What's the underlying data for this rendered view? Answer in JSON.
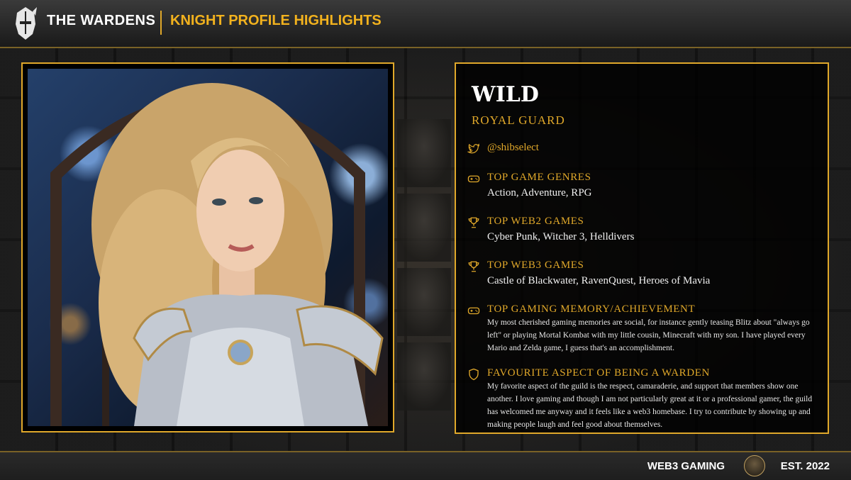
{
  "header": {
    "brand": "THE WARDENS",
    "subtitle": "KNIGHT PROFILE HIGHLIGHTS"
  },
  "profile": {
    "name": "WILD",
    "rank": "ROYAL GUARD",
    "handle": "@shibselect",
    "sections": [
      {
        "icon": "gamepad-icon",
        "heading": "TOP GAME GENRES",
        "value": "Action, Adventure, RPG"
      },
      {
        "icon": "trophy-icon",
        "heading": "TOP WEB2 GAMES",
        "value": "Cyber Punk, Witcher 3, Helldivers"
      },
      {
        "icon": "trophy-icon",
        "heading": "TOP WEB3 GAMES",
        "value": "Castle of Blackwater, RavenQuest, Heroes of Mavia"
      },
      {
        "icon": "gamepad-icon",
        "heading": "TOP GAMING MEMORY/ACHIEVEMENT",
        "value": "My most cherished gaming memories are social, for instance gently teasing Blitz about \"always go left\" or playing Mortal Kombat with my little cousin, Minecraft with my son. I have played every Mario and Zelda game, I guess that's an accomplishment."
      },
      {
        "icon": "shield-icon",
        "heading": "FAVOURITE ASPECT OF BEING A WARDEN",
        "value": "My favorite aspect of the guild is the respect, camaraderie, and support that members show one another. I love gaming and though I am not particularly great at it or a professional gamer, the guild has welcomed me anyway and it feels like a web3 homebase. I try to contribute by showing up and making people laugh and feel good about themselves."
      }
    ]
  },
  "footer": {
    "left": "WEB3 GAMING",
    "right": "EST. 2022"
  },
  "colors": {
    "accent": "#e0a82a",
    "background": "#0d0d0d"
  }
}
